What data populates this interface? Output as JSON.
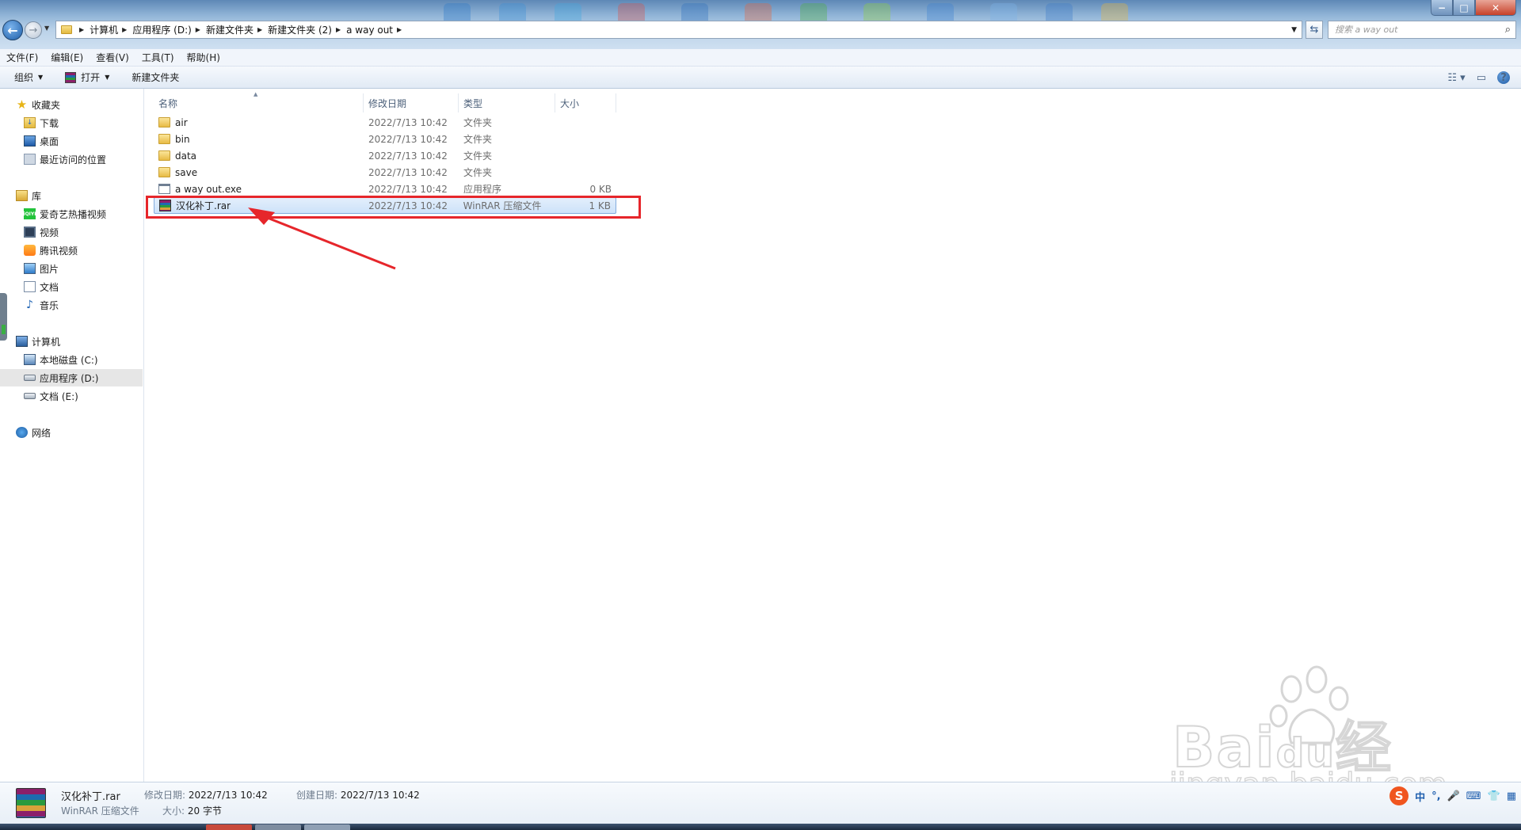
{
  "address": {
    "crumbs": [
      "计算机",
      "应用程序 (D:)",
      "新建文件夹",
      "新建文件夹 (2)",
      "a way out"
    ],
    "search_placeholder": "搜索 a way out"
  },
  "window_buttons": {
    "minimize": "−",
    "maximize": "□",
    "close": "✕"
  },
  "menu": [
    "文件(F)",
    "编辑(E)",
    "查看(V)",
    "工具(T)",
    "帮助(H)"
  ],
  "toolbar": {
    "organize": "组织",
    "open": "打开",
    "new_folder": "新建文件夹"
  },
  "nav": {
    "favorites": {
      "label": "收藏夹",
      "items": [
        "下载",
        "桌面",
        "最近访问的位置"
      ]
    },
    "libraries": {
      "label": "库",
      "items": [
        "爱奇艺热播视频",
        "视频",
        "腾讯视频",
        "图片",
        "文档",
        "音乐"
      ]
    },
    "computer": {
      "label": "计算机",
      "items": [
        "本地磁盘 (C:)",
        "应用程序 (D:)",
        "文档 (E:)"
      ]
    },
    "network": {
      "label": "网络"
    }
  },
  "columns": {
    "name": "名称",
    "date": "修改日期",
    "type": "类型",
    "size": "大小"
  },
  "files": [
    {
      "name": "air",
      "date": "2022/7/13 10:42",
      "type": "文件夹",
      "size": "",
      "icon": "folder-icon"
    },
    {
      "name": "bin",
      "date": "2022/7/13 10:42",
      "type": "文件夹",
      "size": "",
      "icon": "folder-icon"
    },
    {
      "name": "data",
      "date": "2022/7/13 10:42",
      "type": "文件夹",
      "size": "",
      "icon": "folder-icon"
    },
    {
      "name": "save",
      "date": "2022/7/13 10:42",
      "type": "文件夹",
      "size": "",
      "icon": "folder-icon"
    },
    {
      "name": "a way out.exe",
      "date": "2022/7/13 10:42",
      "type": "应用程序",
      "size": "0 KB",
      "icon": "exe-icon"
    },
    {
      "name": "汉化补丁.rar",
      "date": "2022/7/13 10:42",
      "type": "WinRAR 压缩文件",
      "size": "1 KB",
      "icon": "rar-icon"
    }
  ],
  "details": {
    "name": "汉化补丁.rar",
    "type": "WinRAR 压缩文件",
    "modified_label": "修改日期:",
    "modified": "2022/7/13 10:42",
    "created_label": "创建日期:",
    "created": "2022/7/13 10:42",
    "size_label": "大小:",
    "size": "20 字节"
  },
  "watermark": {
    "brand": "Bai",
    "brand2": "du",
    "cn": "经验",
    "url": "jingyan.baidu.com"
  },
  "ime": {
    "lang": "中",
    "punct": "°,"
  },
  "colors": {
    "annotation": "#e6262b",
    "selection": "#cde2f9",
    "accent": "#1d59a8"
  }
}
